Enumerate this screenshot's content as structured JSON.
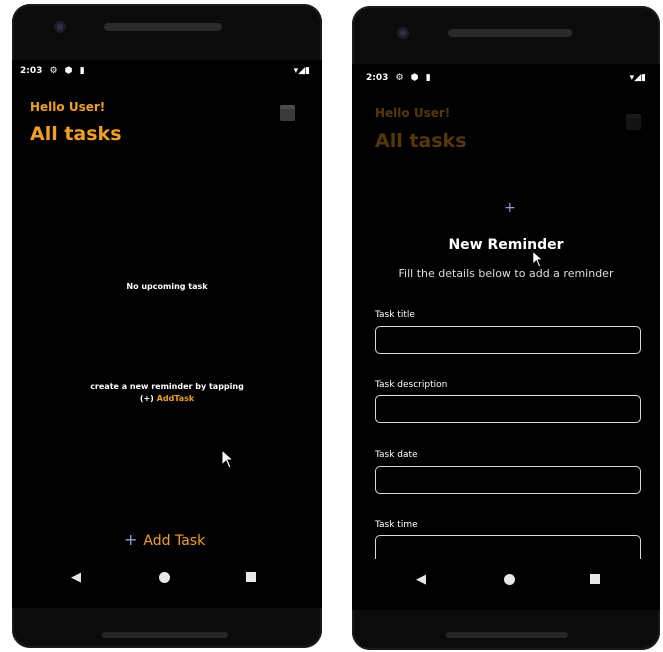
{
  "left": {
    "status": {
      "time": "2:03"
    },
    "header": {
      "greeting": "Hello User!",
      "title": "All tasks"
    },
    "empty": {
      "message": "No upcoming task",
      "hint_line1": "create a new reminder by tapping",
      "hint_prefix": "(+) ",
      "hint_link": "AddTask"
    },
    "add_task_label": "Add Task"
  },
  "right": {
    "status": {
      "time": "2:03"
    },
    "header": {
      "greeting": "Hello User!",
      "title": "All tasks"
    },
    "modal": {
      "plus": "+",
      "title": "New Reminder",
      "subtitle": "Fill the details below to add a reminder",
      "fields": [
        {
          "label": "Task title",
          "value": ""
        },
        {
          "label": "Task description",
          "value": ""
        },
        {
          "label": "Task date",
          "value": ""
        },
        {
          "label": "Task time",
          "value": ""
        }
      ]
    }
  },
  "icons": {
    "back": "◀",
    "home": "home-circle",
    "recents": "recents-square"
  },
  "colors": {
    "accent": "#f0a01a",
    "background": "#000000",
    "plus": "#8fa0d8"
  }
}
